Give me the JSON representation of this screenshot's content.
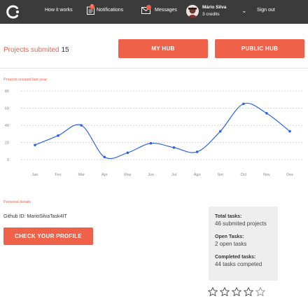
{
  "nav": {
    "how_it_works": "How it works",
    "notifications": "Notifications",
    "notifications_badge": "1",
    "messages": "Messages",
    "user_name": "Mário Silva",
    "user_credits": "3 credits",
    "sign_out": "Sign out"
  },
  "projects": {
    "label": "Projects submited",
    "count": "15",
    "my_hub": "MY HUB",
    "public_hub": "PUBLIC HUB"
  },
  "chart_section": {
    "title": "Projects created last year"
  },
  "chart_data": {
    "type": "line",
    "categories": [
      "Jan",
      "Fev",
      "Mar",
      "Apr",
      "May",
      "Jun",
      "Jul",
      "Ago",
      "Set",
      "Oct",
      "Nov",
      "Dez"
    ],
    "values": [
      17,
      28,
      40,
      3,
      8,
      19,
      14,
      9,
      33,
      65,
      54,
      33
    ],
    "ylim": [
      0,
      80
    ],
    "yticks": [
      "0",
      "20",
      "40",
      "60",
      "80"
    ],
    "grid": true,
    "color": "#2a62e8"
  },
  "personal": {
    "label": "Personal details",
    "github_label": "Github ID:",
    "github_id": "MarioSilvaTask4IT",
    "check_profile": "CHECK YOUR PROFILE"
  },
  "stats": {
    "total_title": "Total tasks:",
    "total_value": "46 submited projects",
    "open_title": "Open Tasks:",
    "open_value": "2 open tasks",
    "completed_title": "Completed tasks:",
    "completed_value": "44 tasks competed"
  },
  "rating": {
    "value": 4,
    "max": 5
  },
  "colors": {
    "accent": "#f0614a",
    "nav_bg": "#3b3b3b",
    "line": "#2a62e8"
  }
}
